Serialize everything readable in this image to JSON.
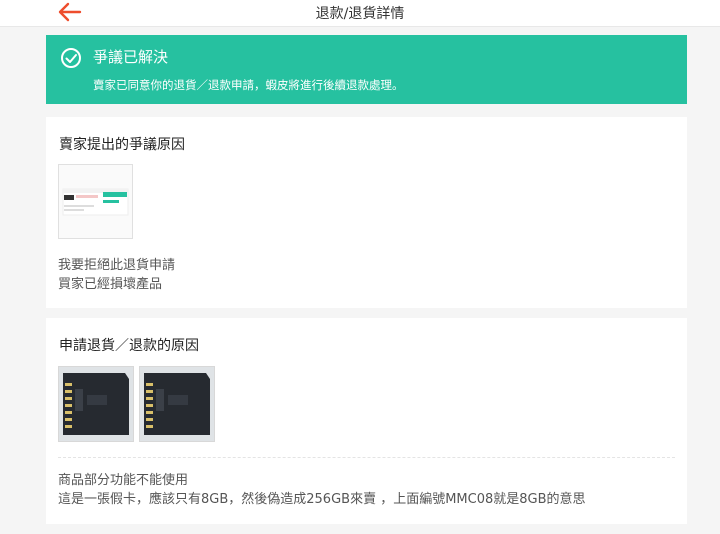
{
  "header": {
    "title": "退款/退貨詳情"
  },
  "banner": {
    "title": "爭議已解決",
    "description": "賣家已同意你的退貨／退款申請，蝦皮將進行後續退款處理。",
    "color": "#26c1a0"
  },
  "seller_reason": {
    "title": "賣家提出的爭議原因",
    "lines": [
      "我要拒絕此退貨申請",
      "買家已經損壞產品"
    ]
  },
  "buyer_reason": {
    "title": "申請退貨／退款的原因",
    "lines": [
      "商品部分功能不能使用",
      "這是一張假卡，應該只有8GB，然後偽造成256GB來賣 ，上面編號MMC08就是8GB的意思"
    ]
  },
  "colors": {
    "accent": "#ee4d2d",
    "banner": "#26c1a0"
  }
}
